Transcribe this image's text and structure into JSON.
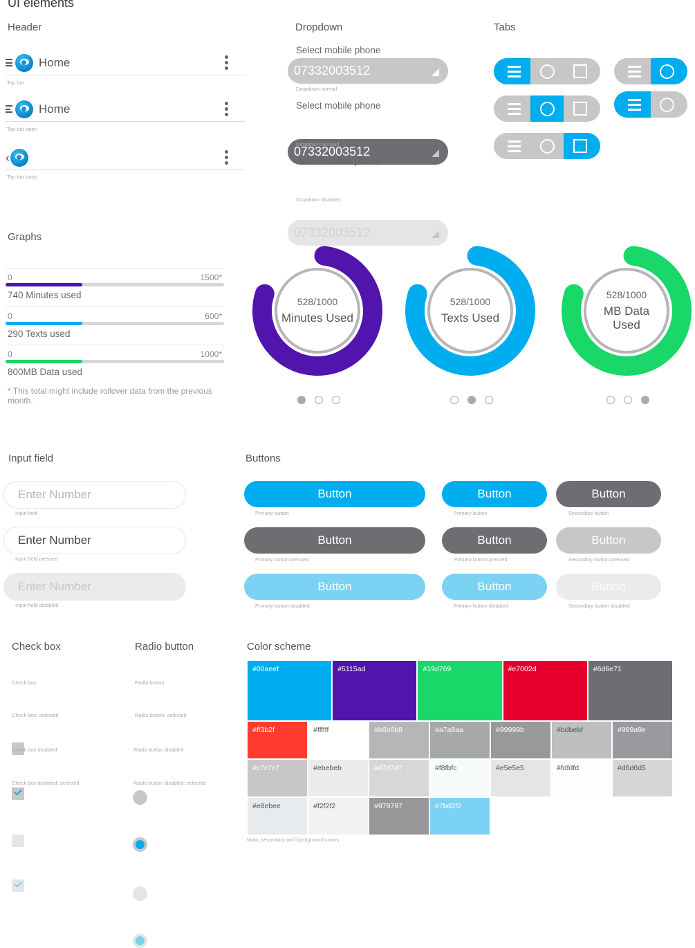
{
  "page_title": "UI elements",
  "header": {
    "section_title": "Header",
    "bars": [
      {
        "variant": "menu",
        "title": "Home",
        "caption": "Top bar"
      },
      {
        "variant": "menu-open",
        "title": "Home",
        "caption": "Top bar open"
      },
      {
        "variant": "back",
        "title": "",
        "caption": "Top bar back"
      }
    ]
  },
  "dropdown": {
    "section_title": "Dropdown",
    "items": [
      {
        "label": "Select mobile phone",
        "value": "07332003512",
        "caption": "Dropdown normal",
        "state": "normal"
      },
      {
        "label": "Select mobile phone",
        "value": "07332003512",
        "caption": "Dropdown focused",
        "state": "focused"
      },
      {
        "label": "Select mobile phone",
        "value": "07332003512",
        "caption": "Dropdown disabled",
        "state": "disabled"
      }
    ]
  },
  "tabs": {
    "section_title": "Tabs",
    "icons": [
      "menu-icon",
      "circle-icon",
      "square-icon"
    ],
    "groups": [
      {
        "tabs": [
          "menu",
          "circle",
          "square"
        ],
        "active": 0
      },
      {
        "tabs": [
          "menu",
          "circle",
          "square"
        ],
        "active": 1
      },
      {
        "tabs": [
          "menu",
          "circle",
          "square"
        ],
        "active": 2
      },
      {
        "tabs": [
          "menu",
          "circle"
        ],
        "active": 1
      },
      {
        "tabs": [
          "menu",
          "circle"
        ],
        "active": 0
      }
    ]
  },
  "graphs": {
    "section_title": "Graphs",
    "bars": [
      {
        "min": "0",
        "max": "1500*",
        "used_label": "740 Minutes used",
        "fill_fraction": 0.35,
        "color": "#5115ad"
      },
      {
        "min": "0",
        "max": "600*",
        "used_label": "290 Texts used",
        "fill_fraction": 0.35,
        "color": "#00aeef"
      },
      {
        "min": "0",
        "max": "1000*",
        "used_label": "800MB Data used",
        "fill_fraction": 0.35,
        "color": "#19d769"
      }
    ],
    "footnote": "* This total might include rollover data from the previous month.",
    "donuts": [
      {
        "value": "528/1000",
        "label": "Minutes Used",
        "fill_fraction": 0.78,
        "color": "#5115ad",
        "page_active": 0
      },
      {
        "value": "528/1000",
        "label": "Texts Used",
        "fill_fraction": 0.78,
        "color": "#00aeef",
        "page_active": 1
      },
      {
        "value": "528/1000",
        "label": "MB Data Used",
        "fill_fraction": 0.78,
        "color": "#19d769",
        "page_active": 2
      }
    ]
  },
  "input_field": {
    "section_title": "Input field",
    "items": [
      {
        "value": "Enter Number",
        "caption": "Input field",
        "state": "placeholder"
      },
      {
        "value": "Enter Number",
        "caption": "Input field pressed",
        "state": "pressed"
      },
      {
        "value": "Enter Number",
        "caption": "Input field disabled",
        "state": "disabled"
      }
    ]
  },
  "buttons": {
    "section_title": "Buttons",
    "label": "Button",
    "captions": {
      "primary": "Primary button",
      "primary_pressed": "Primary button pressed",
      "primary_disabled": "Primary button disabled",
      "secondary": "Secondary button",
      "secondary_pressed": "Secondary button pressed",
      "secondary_disabled": "Secondary button disabled"
    }
  },
  "checkbox": {
    "section_title": "Check box",
    "items": [
      {
        "caption": "Check box",
        "checked": false,
        "disabled": false
      },
      {
        "caption": "Check box: selected",
        "checked": true,
        "disabled": false
      },
      {
        "caption": "Check box disabled",
        "checked": false,
        "disabled": true
      },
      {
        "caption": "Check box disabled: selected",
        "checked": true,
        "disabled": true
      }
    ]
  },
  "radio": {
    "section_title": "Radio button",
    "items": [
      {
        "caption": "Radio button",
        "selected": false,
        "disabled": false
      },
      {
        "caption": "Radio button: selected",
        "selected": true,
        "disabled": false
      },
      {
        "caption": "Radio button disabled",
        "selected": false,
        "disabled": true
      },
      {
        "caption": "Radio button disabled: selected",
        "selected": true,
        "disabled": true
      }
    ]
  },
  "color_scheme": {
    "section_title": "Color scheme",
    "main": [
      "#00aeef",
      "#5115ad",
      "#19d769",
      "#e7002d",
      "#6d6e71"
    ],
    "secondary": [
      [
        "#ff3b2f",
        "#ffffff",
        "#b6b6b8",
        "#a7a8aa",
        "#99999b",
        "#bdbebf",
        "#989a9e"
      ],
      [
        "#c7c7c7",
        "#ebebeb",
        "#d7d7d7",
        "#f8fbfc",
        "#e5e5e5",
        "#fdfdfd",
        "#d6d6d5"
      ],
      [
        "#e8ebee",
        "#f2f2f2",
        "#979797",
        "#7bd2f2"
      ]
    ],
    "caption": "Main, secondary and background colors"
  }
}
